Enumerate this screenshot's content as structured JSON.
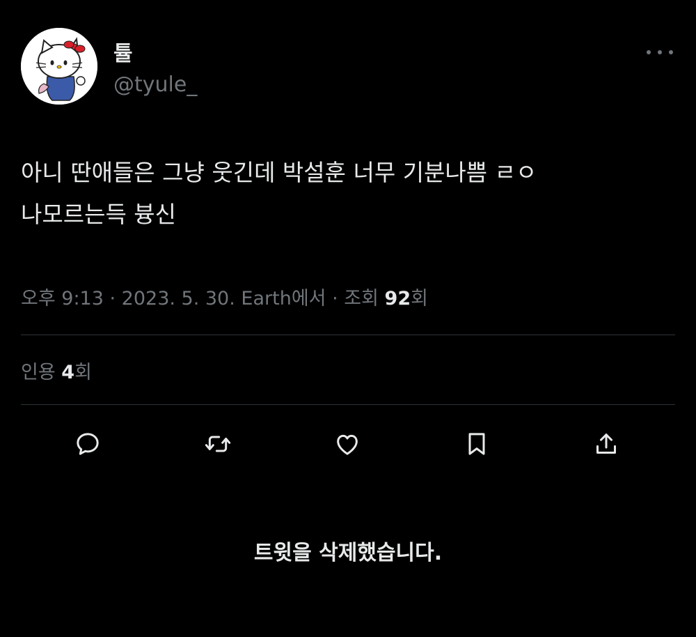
{
  "tweet": {
    "display_name": "튤",
    "handle": "@tyule_",
    "text_lines": [
      "아니 딴애들은 그냥 웃긴데 박설훈 너무 기분나쁨 ㄹㅇ",
      "나모르는득 븅신"
    ],
    "meta": {
      "time": "오후 9:13",
      "separator": " · ",
      "date": "2023. 5. 30.",
      "source": "Earth에서",
      "views_label": "조회 ",
      "views_count": "92",
      "views_suffix": "회"
    },
    "quotes": {
      "label": "인용 ",
      "count": "4",
      "suffix": "회"
    }
  },
  "actions": {
    "reply_icon": "reply-icon",
    "retweet_icon": "retweet-icon",
    "like_icon": "heart-icon",
    "bookmark_icon": "bookmark-icon",
    "share_icon": "share-icon"
  },
  "footer": {
    "deleted_message": "트윗을 삭제했습니다."
  },
  "colors": {
    "background": "#000000",
    "primary_text": "#e7e9ea",
    "secondary_text": "#71767b",
    "divider": "#2f3336"
  }
}
